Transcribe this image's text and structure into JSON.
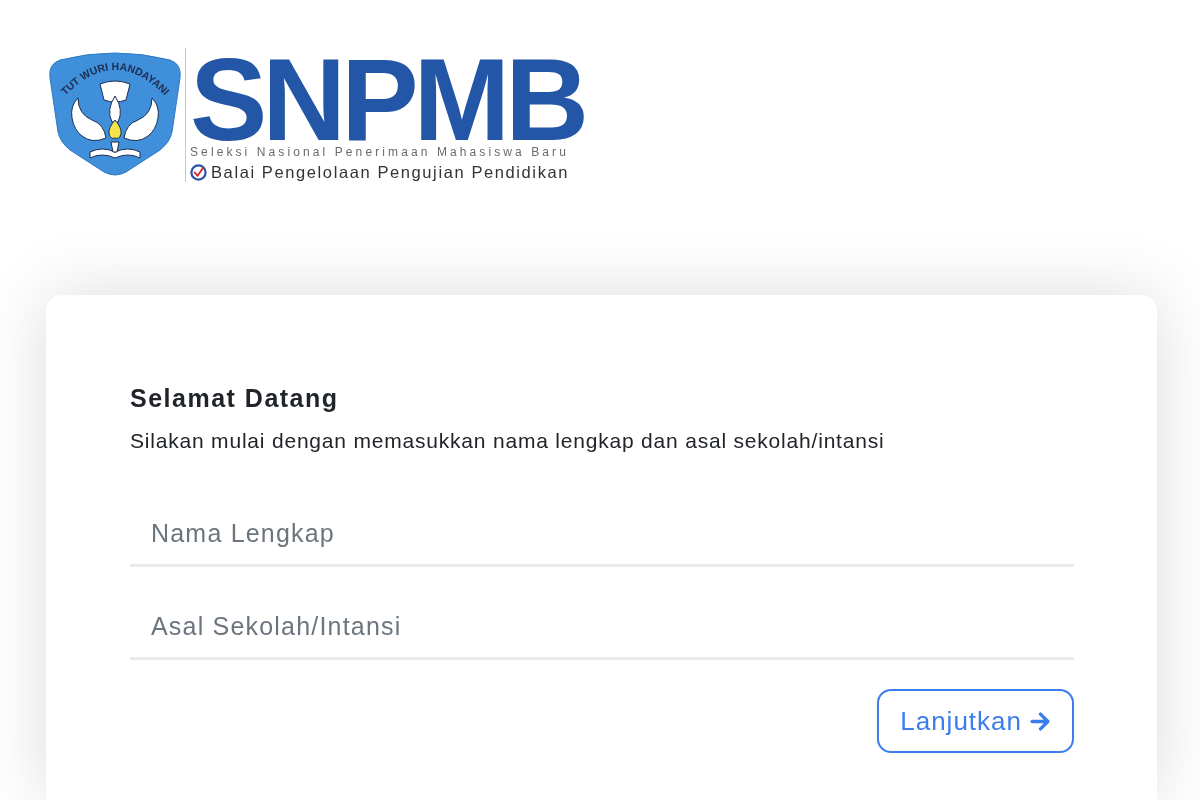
{
  "header": {
    "logo": {
      "emblem_motto": "TUT WURI HANDAYANI",
      "wordmark": "SNPMB",
      "tagline": "Seleksi Nasional Penerimaan Mahasiswa Baru",
      "institution": "Balai Pengelolaan Pengujian Pendidikan"
    }
  },
  "card": {
    "title": "Selamat Datang",
    "subtitle": "Silakan mulai dengan memasukkan nama lengkap dan asal sekolah/intansi",
    "fields": [
      {
        "placeholder": "Nama Lengkap"
      },
      {
        "placeholder": "Asal Sekolah/Intansi"
      }
    ],
    "button": {
      "label": "Lanjutkan"
    }
  }
}
